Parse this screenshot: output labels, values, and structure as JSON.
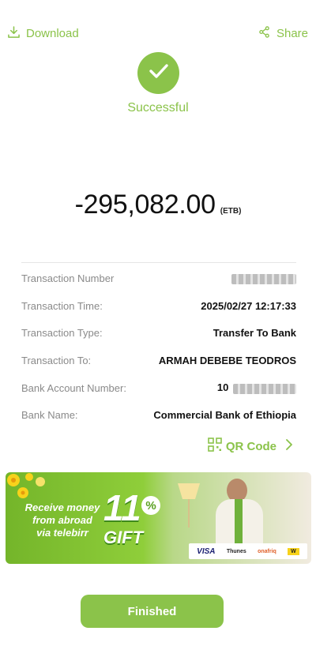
{
  "topbar": {
    "download_label": "Download",
    "share_label": "Share"
  },
  "status": {
    "text": "Successful",
    "icon": "check-icon"
  },
  "amount": {
    "value": "-295,082.00",
    "currency": "(ETB)"
  },
  "details": [
    {
      "label": "Transaction Number",
      "value": "",
      "masked": true
    },
    {
      "label": "Transaction Time:",
      "value": "2025/02/27 12:17:33"
    },
    {
      "label": "Transaction Type:",
      "value": "Transfer To Bank"
    },
    {
      "label": "Transaction To:",
      "value": "ARMAH DEBEBE TEODROS"
    },
    {
      "label": "Bank Account Number:",
      "value": "10",
      "masked": true
    },
    {
      "label": "Bank Name:",
      "value": "Commercial Bank of Ethiopia"
    }
  ],
  "qr": {
    "label": "QR Code",
    "icon": "qr-code-icon"
  },
  "banner": {
    "line1": "Receive money",
    "line2": "from abroad",
    "line3": "via telebirr",
    "promo_number": "11",
    "promo_percent": "%",
    "promo_word": "GIFT",
    "partners": [
      "VISA",
      "Thunes",
      "onafriq",
      "W"
    ]
  },
  "actions": {
    "finish_label": "Finished"
  },
  "colors": {
    "accent": "#8bc34a",
    "text": "#111111",
    "label": "#8a8a8a"
  }
}
